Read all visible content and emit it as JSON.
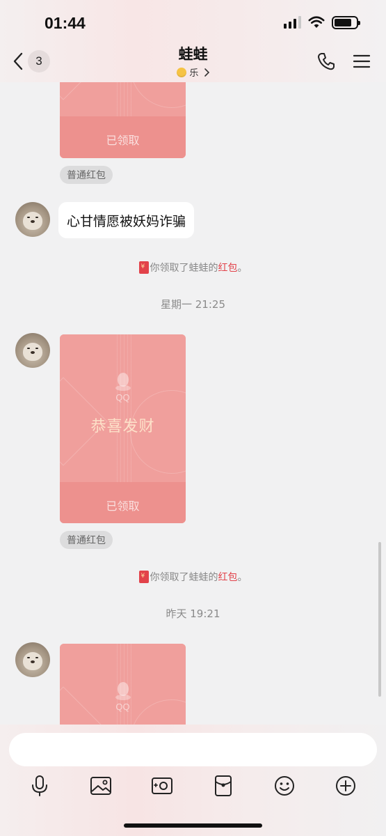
{
  "status_bar": {
    "time": "01:44",
    "icons": [
      "signal-icon",
      "wifi-icon",
      "battery-icon"
    ]
  },
  "header": {
    "unread_count": "3",
    "title": "蛙蛙",
    "subtitle": "乐",
    "icons": [
      "back-chevron-icon",
      "phone-icon",
      "menu-icon"
    ]
  },
  "colors": {
    "accent_red": "#e2424a",
    "packet": "#f09f9c",
    "bubble_bg": "#ffffff",
    "chat_bg": "#f1f1f2"
  },
  "messages": {
    "packet_1": {
      "status": "已领取",
      "tag": "普通红包"
    },
    "text_1": "心甘情愿被妖妈诈骗",
    "system_1": {
      "prefix": "你领取了蛙蛙的",
      "link": "红包",
      "suffix": "。"
    },
    "time_1": "星期一 21:25",
    "packet_2": {
      "brand": "QQ",
      "greeting": "恭喜发财",
      "status": "已领取",
      "tag": "普通红包"
    },
    "system_2": {
      "prefix": "你领取了蛙蛙的",
      "link": "红包",
      "suffix": "。"
    },
    "time_2": "昨天 19:21",
    "packet_3": {
      "brand": "QQ"
    }
  },
  "composer": {
    "value": "",
    "placeholder": "",
    "tools": [
      "microphone-icon",
      "image-icon",
      "camera-icon",
      "red-packet-icon",
      "emoji-icon",
      "plus-icon"
    ]
  }
}
